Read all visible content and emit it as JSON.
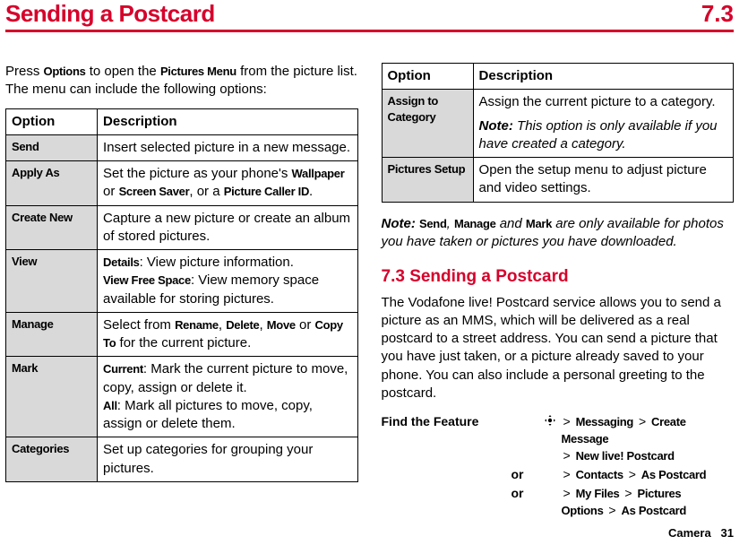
{
  "header": {
    "title": "Sending a Postcard",
    "section_number": "7.3"
  },
  "left": {
    "intro_pre": "Press ",
    "intro_b1": "Options",
    "intro_mid": " to open the ",
    "intro_b2": "Pictures Menu",
    "intro_post": " from the picture list. The menu can include the following options:",
    "th_option": "Option",
    "th_desc": "Description",
    "rows": {
      "send": {
        "name": "Send",
        "desc": "Insert selected picture in a new message."
      },
      "apply": {
        "name": "Apply As",
        "d1": "Set the picture as your phone's ",
        "b1": "Wallpaper",
        "d2": " or ",
        "b2": "Screen Saver",
        "d3": ", or a ",
        "b3": "Picture Caller ID",
        "d4": "."
      },
      "create": {
        "name": "Create New",
        "desc": "Capture a new picture or create an album of stored pictures."
      },
      "view": {
        "name": "View",
        "b1": "Details",
        "d1": ": View picture information.",
        "b2": "View Free Space",
        "d2": ": View memory space available for storing pictures."
      },
      "manage": {
        "name": "Manage",
        "d1": "Select from ",
        "b1": "Rename",
        "c1": ", ",
        "b2": "Delete",
        "c2": ", ",
        "b3": "Move",
        "c3": " or ",
        "b4": "Copy To",
        "d2": " for the current picture."
      },
      "mark": {
        "name": "Mark",
        "b1": "Current",
        "d1": ": Mark the current picture to move, copy, assign or delete it.",
        "b2": "All",
        "d2": ": Mark all pictures to move, copy, assign or delete them."
      },
      "cats": {
        "name": "Categories",
        "desc": "Set up categories for grouping your pictures."
      }
    }
  },
  "right": {
    "th_option": "Option",
    "th_desc": "Description",
    "rows": {
      "assign": {
        "name": "Assign to Category",
        "desc": "Assign the current picture to a category.",
        "note_b": "Note:",
        "note": " This option is only available if you have created a category."
      },
      "setup": {
        "name": "Pictures Setup",
        "desc": "Open the setup menu to adjust picture and video settings."
      }
    },
    "note_line": {
      "b": "Note: ",
      "n1": "Send",
      "c1": ", ",
      "n2": "Manage",
      "c2": " and ",
      "n3": "Mark",
      "tail": " are only available for photos you have taken or pictures you have downloaded."
    },
    "section": {
      "title": "7.3 Sending a Postcard",
      "body": "The Vodafone live! Postcard service allows you to send a picture as an MMS, which will be delivered as a real postcard to a street address. You can send a picture that you have just taken, or a picture already saved to your phone. You can also include a personal greeting to the postcard."
    },
    "find": {
      "label": "Find the Feature",
      "or": "or",
      "gt": ">",
      "r1": {
        "a": "Messaging",
        "b": "Create Message",
        "c": "New live! Postcard"
      },
      "r2": {
        "a": "Contacts",
        "b": "As Postcard"
      },
      "r3": {
        "a": "My Files",
        "b": "Pictures",
        "c": "Options",
        "d": "As Postcard"
      }
    }
  },
  "footer": {
    "section": "Camera",
    "page": "31"
  }
}
